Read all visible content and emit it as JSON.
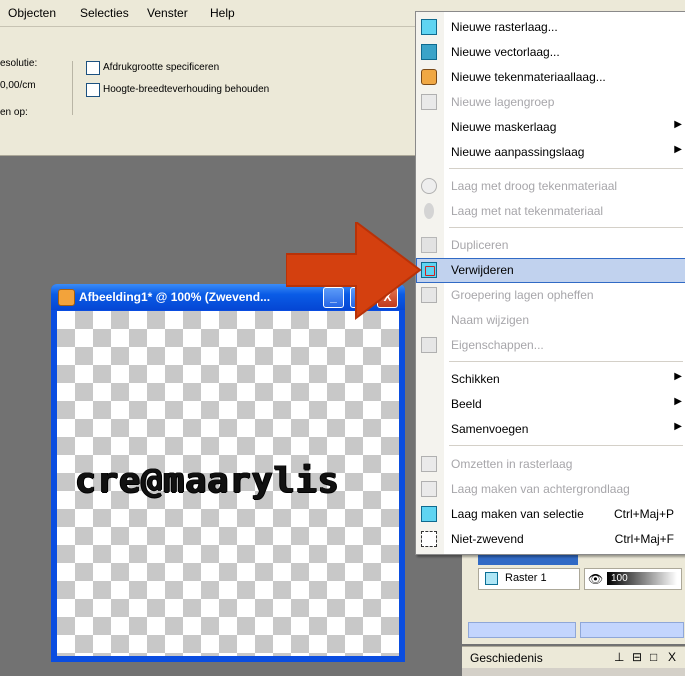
{
  "menubar": {
    "items": [
      "Objecten",
      "Selecties",
      "Venster",
      "Help"
    ],
    "underline": [
      "O",
      "S",
      "V",
      "H"
    ]
  },
  "tool_options": {
    "resolution_label": "esolutie:",
    "resolution_value": "0,00/cm",
    "print_size_label": "Afdrukgrootte specificeren",
    "aspect_label": "Hoogte-breedteverhouding behouden",
    "apply_label": "en op:"
  },
  "image_window": {
    "title": "Afbeelding1* @ 100% (Zwevend...",
    "canvas_text": "cre@maarylis",
    "buttons": [
      "_",
      "□",
      "X"
    ]
  },
  "context_menu": {
    "items": [
      {
        "label": "Nieuwe rasterlaag...",
        "icon": "raster-layer-icon",
        "enabled": true,
        "submenu": false
      },
      {
        "label": "Nieuwe vectorlaag...",
        "icon": "vector-layer-icon",
        "enabled": true,
        "submenu": false
      },
      {
        "label": "Nieuwe tekenmateriaallaag...",
        "icon": "art-media-layer-icon",
        "enabled": true,
        "submenu": false
      },
      {
        "label": "Nieuwe lagengroep",
        "icon": "layer-group-icon",
        "enabled": false,
        "submenu": false
      },
      {
        "label": "Nieuwe maskerlaag",
        "icon": "",
        "enabled": true,
        "submenu": true
      },
      {
        "label": "Nieuwe aanpassingslaag",
        "icon": "",
        "enabled": true,
        "submenu": true
      },
      {
        "label": "Laag met droog tekenmateriaal",
        "icon": "dry-media-icon",
        "enabled": false,
        "submenu": false
      },
      {
        "label": "Laag met nat tekenmateriaal",
        "icon": "wet-media-icon",
        "enabled": false,
        "submenu": false
      },
      {
        "label": "Dupliceren",
        "icon": "duplicate-icon",
        "enabled": false,
        "submenu": false
      },
      {
        "label": "Verwijderen",
        "icon": "delete-layer-icon",
        "enabled": true,
        "submenu": false,
        "highlighted": true
      },
      {
        "label": "Groepering lagen opheffen",
        "icon": "ungroup-icon",
        "enabled": false,
        "submenu": false
      },
      {
        "label": "Naam wijzigen",
        "icon": "",
        "enabled": false,
        "submenu": false
      },
      {
        "label": "Eigenschappen...",
        "icon": "properties-icon",
        "enabled": false,
        "submenu": false
      },
      {
        "label": "Schikken",
        "icon": "",
        "enabled": true,
        "submenu": true
      },
      {
        "label": "Beeld",
        "icon": "",
        "enabled": true,
        "submenu": true
      },
      {
        "label": "Samenvoegen",
        "icon": "",
        "enabled": true,
        "submenu": true
      },
      {
        "label": "Omzetten in rasterlaag",
        "icon": "convert-raster-icon",
        "enabled": false,
        "submenu": false
      },
      {
        "label": "Laag maken van achtergrondlaag",
        "icon": "promote-background-icon",
        "enabled": false,
        "submenu": false
      },
      {
        "label": "Laag maken van selectie",
        "icon": "layer-from-selection-icon",
        "enabled": true,
        "submenu": false,
        "shortcut": "Ctrl+Maj+P"
      },
      {
        "label": "Niet-zwevend",
        "icon": "defloat-icon",
        "enabled": true,
        "submenu": false,
        "shortcut": "Ctrl+Maj+F"
      }
    ]
  },
  "layers_panel": {
    "layer_name": "Raster 1",
    "opacity": "100"
  },
  "history_panel": {
    "title": "Geschiedenis",
    "controls": [
      "⊥",
      "⊟",
      "□",
      "X"
    ]
  },
  "colors": {
    "highlight": "#c1d2ee",
    "arrow": "#d4400f",
    "titlebar": "#0a5ce6"
  }
}
